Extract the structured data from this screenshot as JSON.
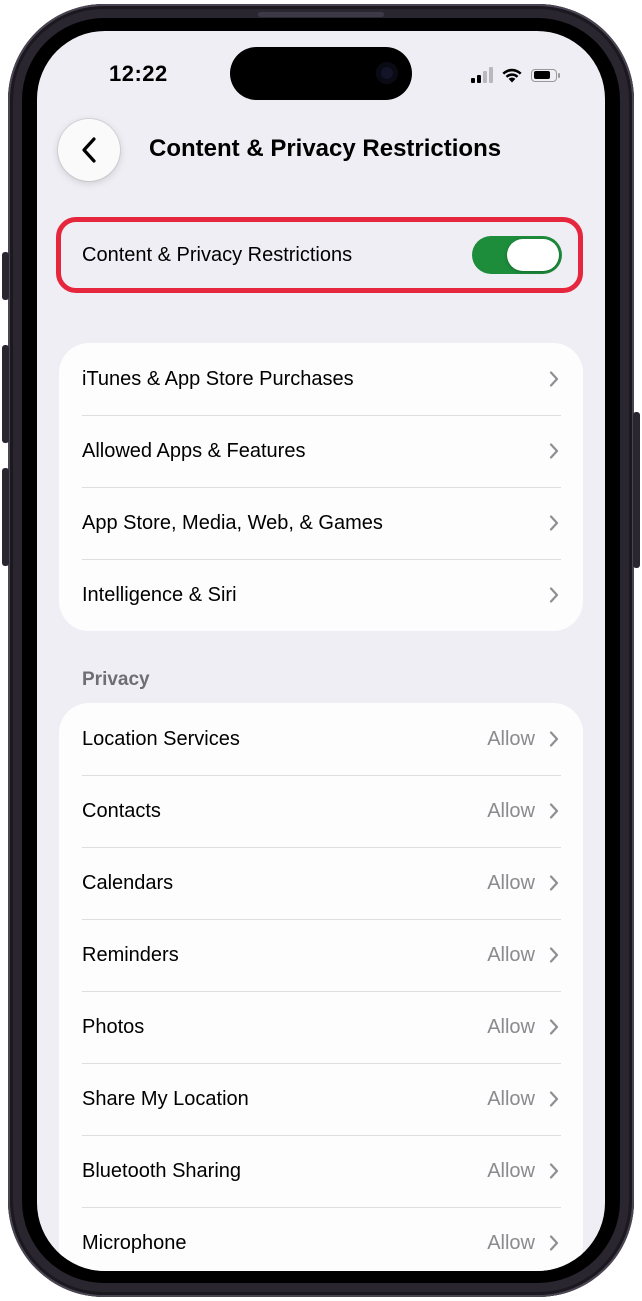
{
  "status_bar": {
    "time": "12:22"
  },
  "nav": {
    "back_icon": "chevron-left-icon",
    "title": "Content & Privacy Restrictions"
  },
  "master_toggle": {
    "label": "Content & Privacy Restrictions",
    "on": true,
    "accent": "#1d8c3b",
    "highlight_color": "#e5263d"
  },
  "general_items": [
    {
      "label": "iTunes & App Store Purchases"
    },
    {
      "label": "Allowed Apps & Features"
    },
    {
      "label": "App Store, Media, Web, & Games"
    },
    {
      "label": "Intelligence & Siri"
    }
  ],
  "privacy": {
    "header": "Privacy",
    "items": [
      {
        "label": "Location Services",
        "value": "Allow"
      },
      {
        "label": "Contacts",
        "value": "Allow"
      },
      {
        "label": "Calendars",
        "value": "Allow"
      },
      {
        "label": "Reminders",
        "value": "Allow"
      },
      {
        "label": "Photos",
        "value": "Allow"
      },
      {
        "label": "Share My Location",
        "value": "Allow"
      },
      {
        "label": "Bluetooth Sharing",
        "value": "Allow"
      },
      {
        "label": "Microphone",
        "value": "Allow"
      }
    ]
  }
}
